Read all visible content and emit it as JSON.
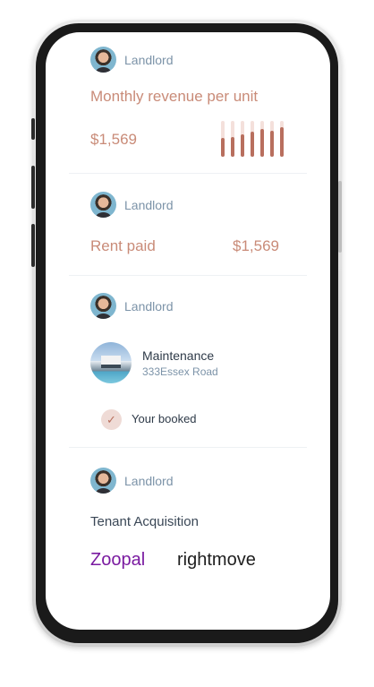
{
  "cards": [
    {
      "role": "Landlord",
      "title": "Monthly revenue per unit",
      "amount": "$1,569",
      "bars": [
        {
          "total": 1.0,
          "fill": 0.52
        },
        {
          "total": 1.0,
          "fill": 0.55
        },
        {
          "total": 1.0,
          "fill": 0.62
        },
        {
          "total": 1.0,
          "fill": 0.7
        },
        {
          "total": 1.0,
          "fill": 0.78
        },
        {
          "total": 1.0,
          "fill": 0.73
        },
        {
          "total": 1.0,
          "fill": 0.82
        }
      ]
    },
    {
      "role": "Landlord",
      "title": "Rent paid",
      "amount": "$1,569"
    },
    {
      "role": "Landlord",
      "maintenance": {
        "title": "Maintenance",
        "address": "333Essex Road"
      },
      "status": "Your booked"
    },
    {
      "role": "Landlord",
      "title": "Tenant Acquisition",
      "partners": [
        "Zoopal",
        "rightmove"
      ]
    }
  ],
  "colors": {
    "accent": "#c98b78",
    "bar_fill": "#b86f5e",
    "bar_track": "#f4e0db",
    "zoopla": "#7a1aa0"
  },
  "icons": {
    "check": "check-icon"
  }
}
